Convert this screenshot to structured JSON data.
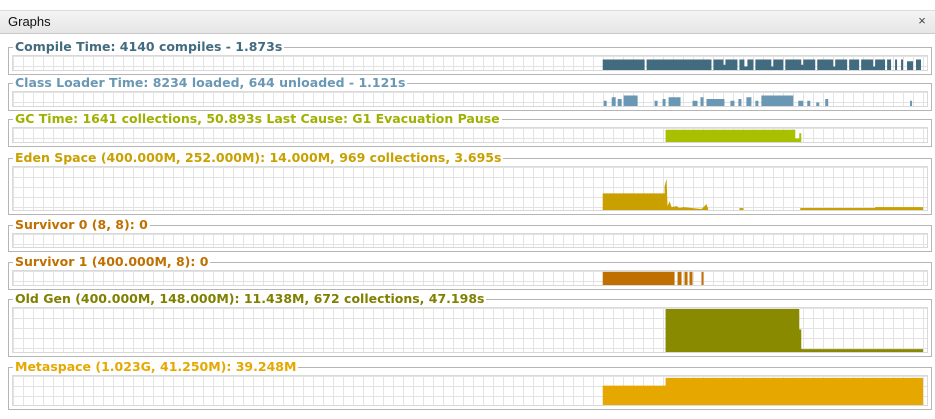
{
  "window": {
    "title": "Graphs",
    "close_label": "×"
  },
  "colors": {
    "compile": "#436b7f",
    "classloader": "#6a98b4",
    "gc": "#a8c000",
    "eden": "#c9a000",
    "survivor0": "#c07000",
    "survivor1": "#c07000",
    "oldgen": "#8a8a00",
    "metaspace": "#e6a800"
  },
  "panels": [
    {
      "key": "compile",
      "title": "Compile Time: 4140 compiles - 1.873s",
      "title_color": "#436b7f"
    },
    {
      "key": "classloader",
      "title": "Class Loader Time: 8234 loaded, 644 unloaded - 1.121s",
      "title_color": "#6a98b4"
    },
    {
      "key": "gc",
      "title": "GC Time: 1641 collections, 50.893s  Last Cause: G1 Evacuation Pause",
      "title_color": "#a0b000"
    },
    {
      "key": "eden",
      "title": "Eden Space (400.000M, 252.000M): 14.000M, 969 collections, 3.695s",
      "title_color": "#c9a000"
    },
    {
      "key": "survivor0",
      "title": "Survivor 0 (8, 8): 0",
      "title_color": "#c07000"
    },
    {
      "key": "survivor1",
      "title": "Survivor 1 (400.000M, 8): 0",
      "title_color": "#c07000"
    },
    {
      "key": "oldgen",
      "title": "Old Gen (400.000M, 148.000M): 11.438M, 672 collections, 47.198s",
      "title_color": "#808000"
    },
    {
      "key": "metaspace",
      "title": "Metaspace (1.023G, 41.250M): 39.248M",
      "title_color": "#e6a800"
    }
  ]
}
